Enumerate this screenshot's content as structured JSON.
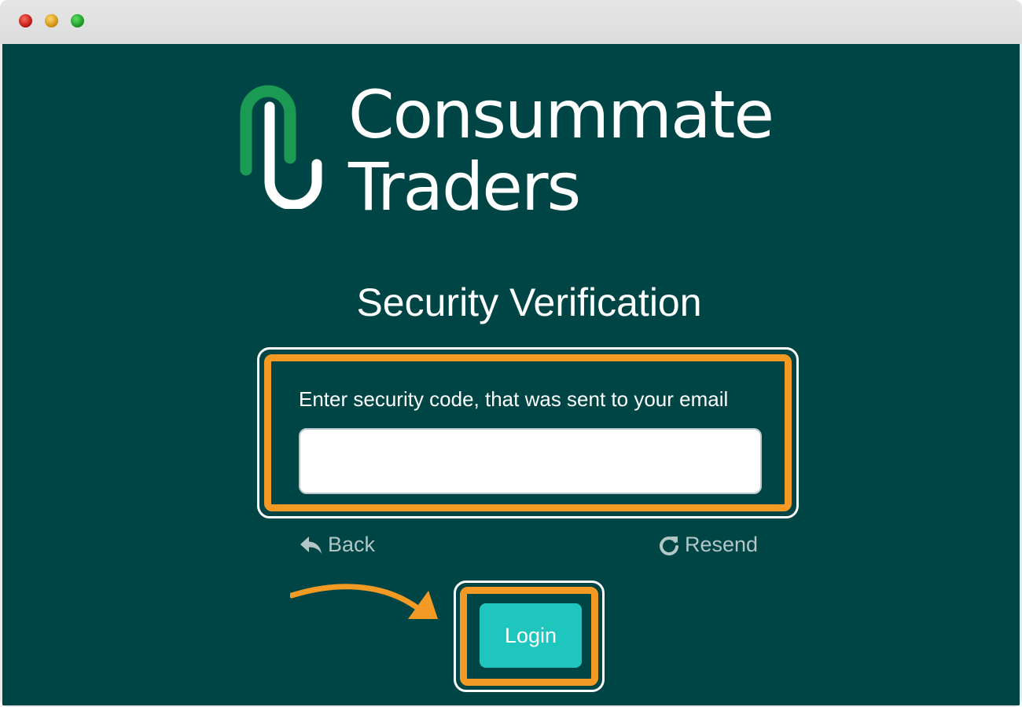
{
  "brand": {
    "name_line1": "Consummate",
    "name_line2": "Traders",
    "color_green": "#1a9a53",
    "color_bg": "#004545"
  },
  "page": {
    "title": "Security Verification"
  },
  "form": {
    "label": "Enter security code, that was sent to your email",
    "code_value": "",
    "code_placeholder": ""
  },
  "links": {
    "back_label": "Back",
    "back_icon": "reply-arrow-icon",
    "resend_label": "Resend",
    "resend_icon": "refresh-icon"
  },
  "actions": {
    "login_label": "Login",
    "login_color": "#1ec6bd"
  },
  "annotation": {
    "highlight_color": "#f39a24",
    "pointer_icon": "curved-arrow-icon"
  }
}
